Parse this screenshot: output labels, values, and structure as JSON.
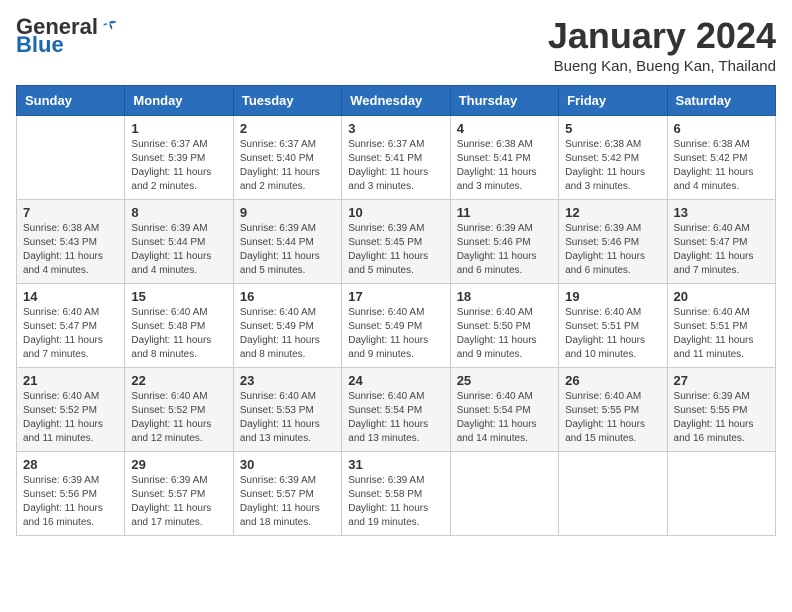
{
  "header": {
    "logo_general": "General",
    "logo_blue": "Blue",
    "title": "January 2024",
    "subtitle": "Bueng Kan, Bueng Kan, Thailand"
  },
  "weekdays": [
    "Sunday",
    "Monday",
    "Tuesday",
    "Wednesday",
    "Thursday",
    "Friday",
    "Saturday"
  ],
  "weeks": [
    [
      {
        "day": "",
        "info": ""
      },
      {
        "day": "1",
        "info": "Sunrise: 6:37 AM\nSunset: 5:39 PM\nDaylight: 11 hours\nand 2 minutes."
      },
      {
        "day": "2",
        "info": "Sunrise: 6:37 AM\nSunset: 5:40 PM\nDaylight: 11 hours\nand 2 minutes."
      },
      {
        "day": "3",
        "info": "Sunrise: 6:37 AM\nSunset: 5:41 PM\nDaylight: 11 hours\nand 3 minutes."
      },
      {
        "day": "4",
        "info": "Sunrise: 6:38 AM\nSunset: 5:41 PM\nDaylight: 11 hours\nand 3 minutes."
      },
      {
        "day": "5",
        "info": "Sunrise: 6:38 AM\nSunset: 5:42 PM\nDaylight: 11 hours\nand 3 minutes."
      },
      {
        "day": "6",
        "info": "Sunrise: 6:38 AM\nSunset: 5:42 PM\nDaylight: 11 hours\nand 4 minutes."
      }
    ],
    [
      {
        "day": "7",
        "info": "Sunrise: 6:38 AM\nSunset: 5:43 PM\nDaylight: 11 hours\nand 4 minutes."
      },
      {
        "day": "8",
        "info": "Sunrise: 6:39 AM\nSunset: 5:44 PM\nDaylight: 11 hours\nand 4 minutes."
      },
      {
        "day": "9",
        "info": "Sunrise: 6:39 AM\nSunset: 5:44 PM\nDaylight: 11 hours\nand 5 minutes."
      },
      {
        "day": "10",
        "info": "Sunrise: 6:39 AM\nSunset: 5:45 PM\nDaylight: 11 hours\nand 5 minutes."
      },
      {
        "day": "11",
        "info": "Sunrise: 6:39 AM\nSunset: 5:46 PM\nDaylight: 11 hours\nand 6 minutes."
      },
      {
        "day": "12",
        "info": "Sunrise: 6:39 AM\nSunset: 5:46 PM\nDaylight: 11 hours\nand 6 minutes."
      },
      {
        "day": "13",
        "info": "Sunrise: 6:40 AM\nSunset: 5:47 PM\nDaylight: 11 hours\nand 7 minutes."
      }
    ],
    [
      {
        "day": "14",
        "info": "Sunrise: 6:40 AM\nSunset: 5:47 PM\nDaylight: 11 hours\nand 7 minutes."
      },
      {
        "day": "15",
        "info": "Sunrise: 6:40 AM\nSunset: 5:48 PM\nDaylight: 11 hours\nand 8 minutes."
      },
      {
        "day": "16",
        "info": "Sunrise: 6:40 AM\nSunset: 5:49 PM\nDaylight: 11 hours\nand 8 minutes."
      },
      {
        "day": "17",
        "info": "Sunrise: 6:40 AM\nSunset: 5:49 PM\nDaylight: 11 hours\nand 9 minutes."
      },
      {
        "day": "18",
        "info": "Sunrise: 6:40 AM\nSunset: 5:50 PM\nDaylight: 11 hours\nand 9 minutes."
      },
      {
        "day": "19",
        "info": "Sunrise: 6:40 AM\nSunset: 5:51 PM\nDaylight: 11 hours\nand 10 minutes."
      },
      {
        "day": "20",
        "info": "Sunrise: 6:40 AM\nSunset: 5:51 PM\nDaylight: 11 hours\nand 11 minutes."
      }
    ],
    [
      {
        "day": "21",
        "info": "Sunrise: 6:40 AM\nSunset: 5:52 PM\nDaylight: 11 hours\nand 11 minutes."
      },
      {
        "day": "22",
        "info": "Sunrise: 6:40 AM\nSunset: 5:52 PM\nDaylight: 11 hours\nand 12 minutes."
      },
      {
        "day": "23",
        "info": "Sunrise: 6:40 AM\nSunset: 5:53 PM\nDaylight: 11 hours\nand 13 minutes."
      },
      {
        "day": "24",
        "info": "Sunrise: 6:40 AM\nSunset: 5:54 PM\nDaylight: 11 hours\nand 13 minutes."
      },
      {
        "day": "25",
        "info": "Sunrise: 6:40 AM\nSunset: 5:54 PM\nDaylight: 11 hours\nand 14 minutes."
      },
      {
        "day": "26",
        "info": "Sunrise: 6:40 AM\nSunset: 5:55 PM\nDaylight: 11 hours\nand 15 minutes."
      },
      {
        "day": "27",
        "info": "Sunrise: 6:39 AM\nSunset: 5:55 PM\nDaylight: 11 hours\nand 16 minutes."
      }
    ],
    [
      {
        "day": "28",
        "info": "Sunrise: 6:39 AM\nSunset: 5:56 PM\nDaylight: 11 hours\nand 16 minutes."
      },
      {
        "day": "29",
        "info": "Sunrise: 6:39 AM\nSunset: 5:57 PM\nDaylight: 11 hours\nand 17 minutes."
      },
      {
        "day": "30",
        "info": "Sunrise: 6:39 AM\nSunset: 5:57 PM\nDaylight: 11 hours\nand 18 minutes."
      },
      {
        "day": "31",
        "info": "Sunrise: 6:39 AM\nSunset: 5:58 PM\nDaylight: 11 hours\nand 19 minutes."
      },
      {
        "day": "",
        "info": ""
      },
      {
        "day": "",
        "info": ""
      },
      {
        "day": "",
        "info": ""
      }
    ]
  ]
}
